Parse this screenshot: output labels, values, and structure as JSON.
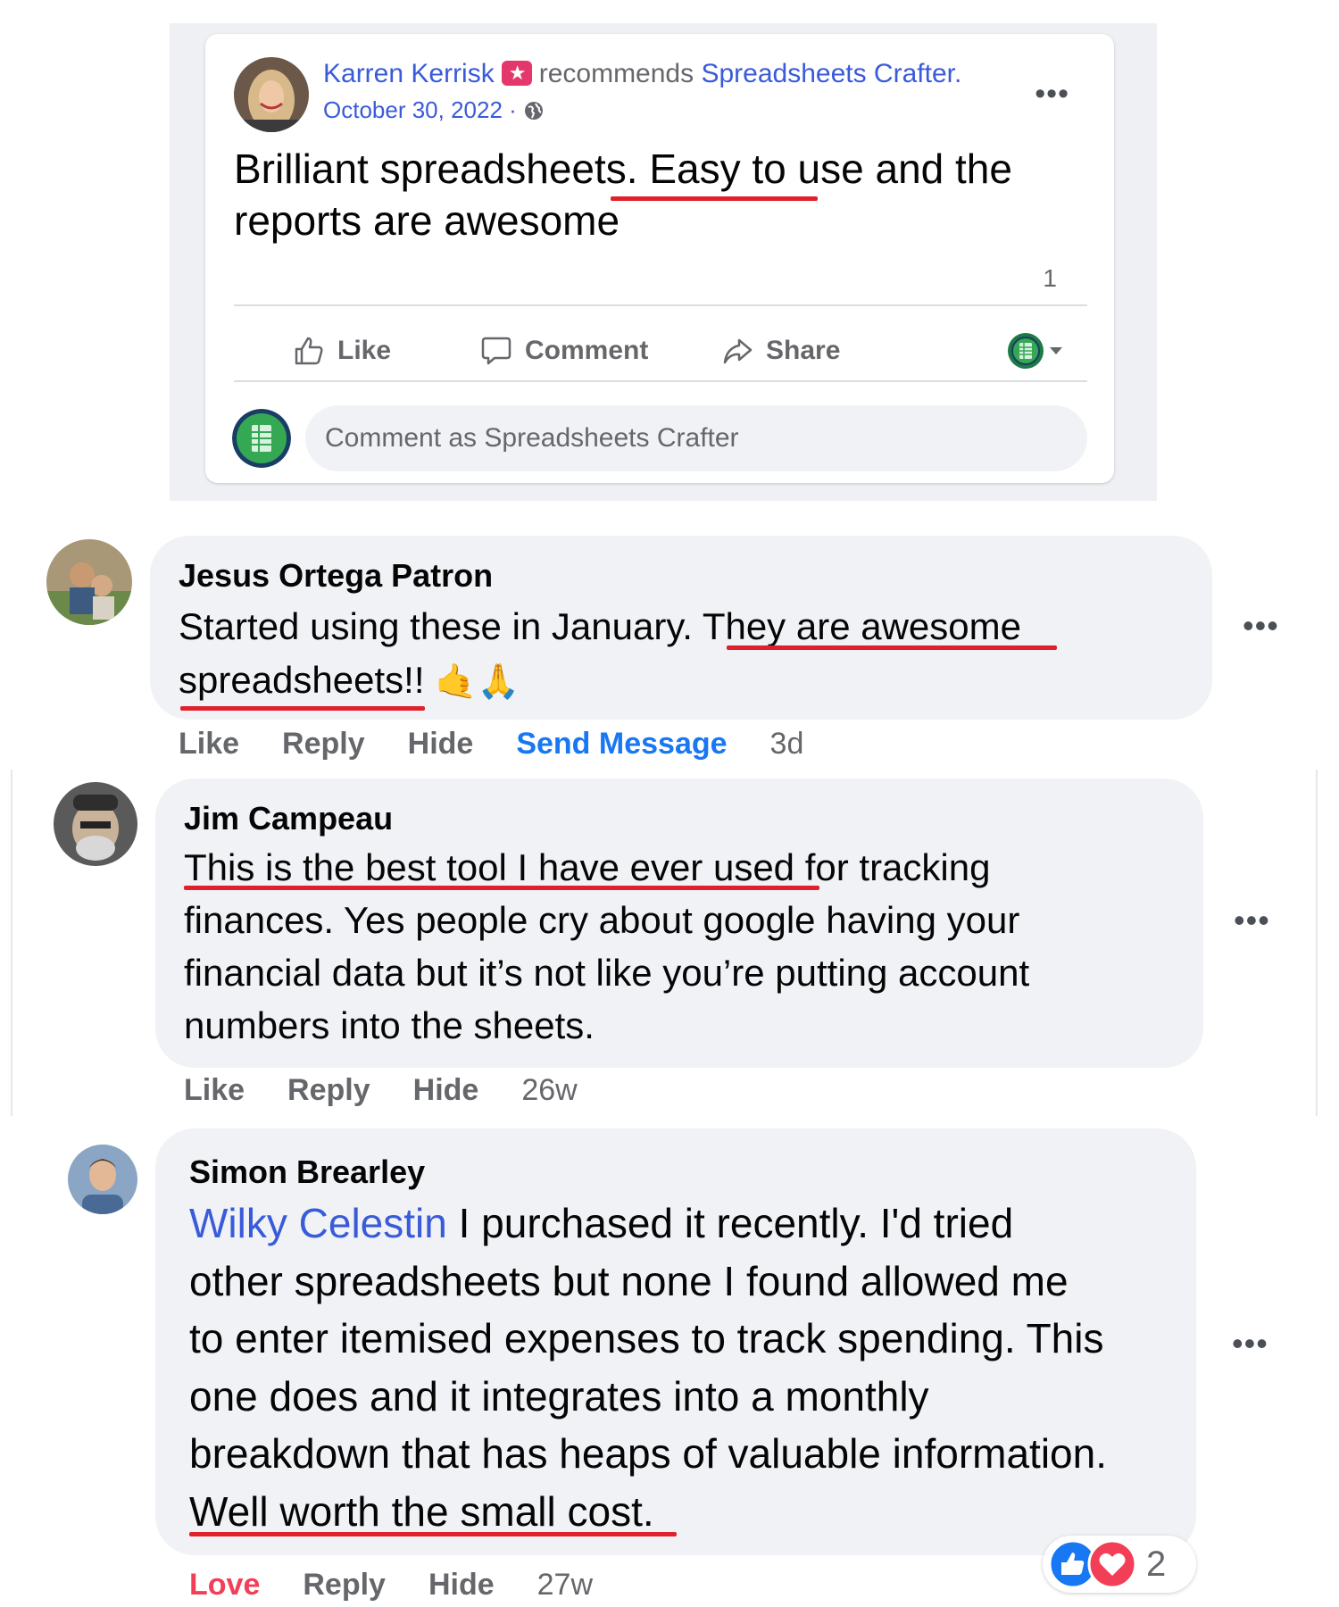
{
  "post": {
    "author": "Karren Kerrisk",
    "action_text": "recommends",
    "page_name": "Spreadsheets Crafter",
    "trailing_period": ".",
    "date": "October 30, 2022",
    "separator": "·",
    "text_part1": "Brilliant spreadsheets. ",
    "text_highlight": "Easy to use",
    "text_part2": " and the reports are awesome",
    "comment_count": "1",
    "more_label": "•••",
    "actions": {
      "like": "Like",
      "comment": "Comment",
      "share": "Share"
    },
    "comment_placeholder": "Comment as Spreadsheets Crafter"
  },
  "comments": [
    {
      "name": "Jesus Ortega Patron",
      "line1_plain": "Started using these in January. ",
      "line1_highlight": "They are awesome",
      "line2_highlight": "spreadsheets!!",
      "emojis": "🤙🙏",
      "actions": {
        "like": "Like",
        "reply": "Reply",
        "hide": "Hide",
        "send": "Send Message",
        "time": "3d"
      },
      "more_label": "•••"
    },
    {
      "name": "Jim Campeau",
      "line1_highlight": "This is the best tool I have ever used",
      "line1_plain": " for tracking",
      "line2": "finances. Yes people cry about google having your",
      "line3": "financial data but it’s not like you’re putting account",
      "line4": "numbers into the sheets.",
      "actions": {
        "like": "Like",
        "reply": "Reply",
        "hide": "Hide",
        "time": "26w"
      },
      "more_label": "•••"
    },
    {
      "name": "Simon Brearley",
      "mention": "Wilky Celestin",
      "line1_plain": " I purchased it recently. I'd tried",
      "line2": "other spreadsheets but none I found allowed me",
      "line3": "to enter itemised expenses to track spending. This",
      "line4": "one does and it integrates into a monthly",
      "line5": "breakdown that has heaps of valuable information.",
      "line6_highlight": "Well worth the small cost.",
      "reaction_count": "2",
      "actions": {
        "love": "Love",
        "reply": "Reply",
        "hide": "Hide",
        "time": "27w"
      },
      "more_label": "•••"
    }
  ],
  "colors": {
    "link": "#3a5bd9",
    "underline": "#e0202a",
    "bubble": "#f0f2f5",
    "love": "#f33e58",
    "send_message": "#1877f2"
  }
}
